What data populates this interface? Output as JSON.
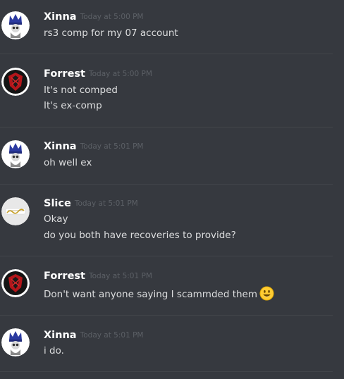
{
  "colors": {
    "background": "#36393f",
    "author": "#ffffff",
    "text": "#dcddde",
    "timestamp": "#5c6066",
    "divider": "#42454a"
  },
  "messages": [
    {
      "author": "Xinna",
      "timestamp": "Today at 5:00 PM",
      "avatar_icon": "mage-hat-avatar-icon",
      "lines": [
        "rs3 comp for my 07 account"
      ]
    },
    {
      "author": "Forrest",
      "timestamp": "Today at 5:00 PM",
      "avatar_icon": "red-crest-avatar-icon",
      "lines": [
        "It's not comped",
        "It's ex-comp"
      ]
    },
    {
      "author": "Xinna",
      "timestamp": "Today at 5:01 PM",
      "avatar_icon": "mage-hat-avatar-icon",
      "lines": [
        "oh well ex"
      ]
    },
    {
      "author": "Slice",
      "timestamp": "Today at 5:01 PM",
      "avatar_icon": "logo-avatar-icon",
      "lines": [
        "Okay",
        "do you both have recoveries to provide?"
      ]
    },
    {
      "author": "Forrest",
      "timestamp": "Today at 5:01 PM",
      "avatar_icon": "red-crest-avatar-icon",
      "lines": [
        "Don't want anyone saying I scammded them"
      ],
      "emoji": "smiley-emoji-icon"
    },
    {
      "author": "Xinna",
      "timestamp": "Today at 5:01 PM",
      "avatar_icon": "mage-hat-avatar-icon",
      "lines": [
        "i do."
      ]
    }
  ]
}
